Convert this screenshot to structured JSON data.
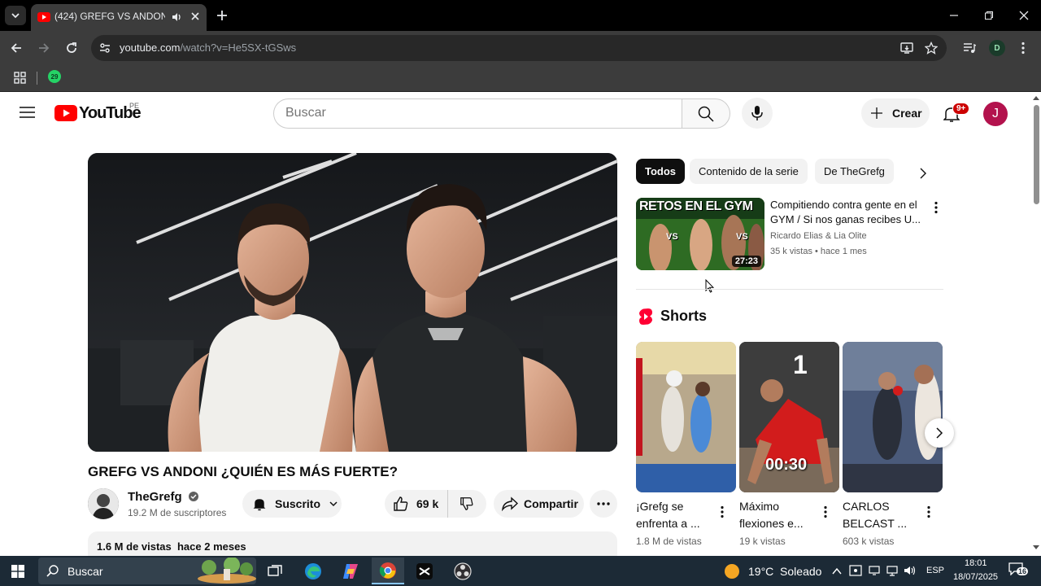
{
  "browser": {
    "tab_title": "(424) GREFG VS ANDONI ¿QUIÉN ES MÁS FUERTE?",
    "url_host": "youtube.com",
    "url_path": "/watch?v=He5SX-tGSws",
    "profile_initial": "D",
    "whatsapp_badge": "29"
  },
  "youtube": {
    "logo_text": "YouTube",
    "region": "PE",
    "search_placeholder": "Buscar",
    "create_label": "Crear",
    "notifications_badge": "9+",
    "avatar_initial": "J"
  },
  "video": {
    "title": "GREFG VS ANDONI ¿QUIÉN ES MÁS FUERTE?",
    "channel": "TheGrefg",
    "subscribers": "19.2 M de suscriptores",
    "subscribe_label": "Suscrito",
    "likes": "69 k",
    "share_label": "Compartir",
    "views_line": "1.6 M de vistas  hace 2 meses"
  },
  "sidebar": {
    "chips": [
      "Todos",
      "Contenido de la serie",
      "De TheGrefg"
    ],
    "recommended": {
      "title": "Compitiendo contra gente en el GYM / Si nos ganas recibes U...",
      "thumb_text": "RETOS EN EL GYM",
      "thumb_vs": "VS",
      "duration": "27:23",
      "channel": "Ricardo Elias & Lia Olite",
      "meta": "35 k vistas • hace 1 mes"
    },
    "shorts_label": "Shorts",
    "shorts": [
      {
        "title": "¡Grefg se enfrenta a ...",
        "views": "1.8 M de vistas",
        "overlay": ""
      },
      {
        "title": "Máximo flexiones e...",
        "views": "19 k vistas",
        "overlay": "00:30",
        "overlay_top": "1"
      },
      {
        "title": "CARLOS BELCAST ...",
        "views": "603 k vistas",
        "overlay": ""
      }
    ]
  },
  "taskbar": {
    "search_placeholder": "Buscar",
    "weather": "19°C  Soleado",
    "language": "ESP",
    "time": "18:01",
    "date": "18/07/2025",
    "notifications": "16"
  },
  "colors": {
    "youtube_red": "#ff0000",
    "chrome_dark": "#3c3c3c",
    "taskbar": "#1c2a36"
  }
}
